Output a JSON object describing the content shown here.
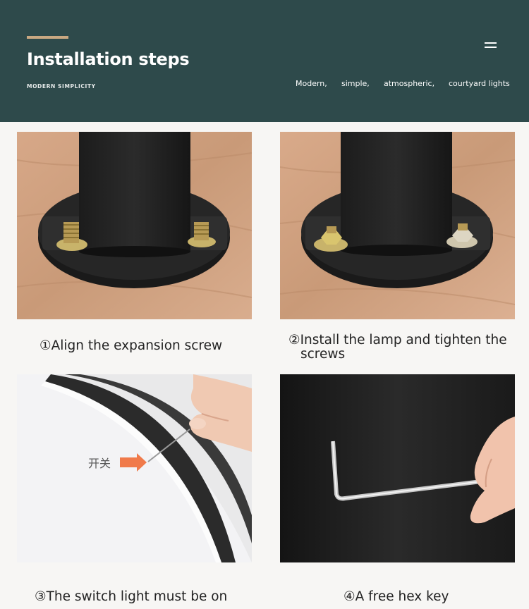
{
  "header": {
    "title": "Installation steps",
    "subtitle": "MODERN SIMPLICITY",
    "taglines": [
      "Modern,",
      "simple,",
      "atmospheric,",
      "courtyard lights"
    ],
    "menu_icon": "menu-icon",
    "colors": {
      "background": "#2e4a4b",
      "accent": "#c9a882"
    }
  },
  "steps": [
    {
      "caption": "①Align the expansion screw"
    },
    {
      "caption": "②Install the lamp and tighten the",
      "caption_cont": "screws"
    },
    {
      "caption": "③The switch light must be on",
      "photo_label": "开关"
    },
    {
      "caption": "④A free hex key"
    }
  ]
}
